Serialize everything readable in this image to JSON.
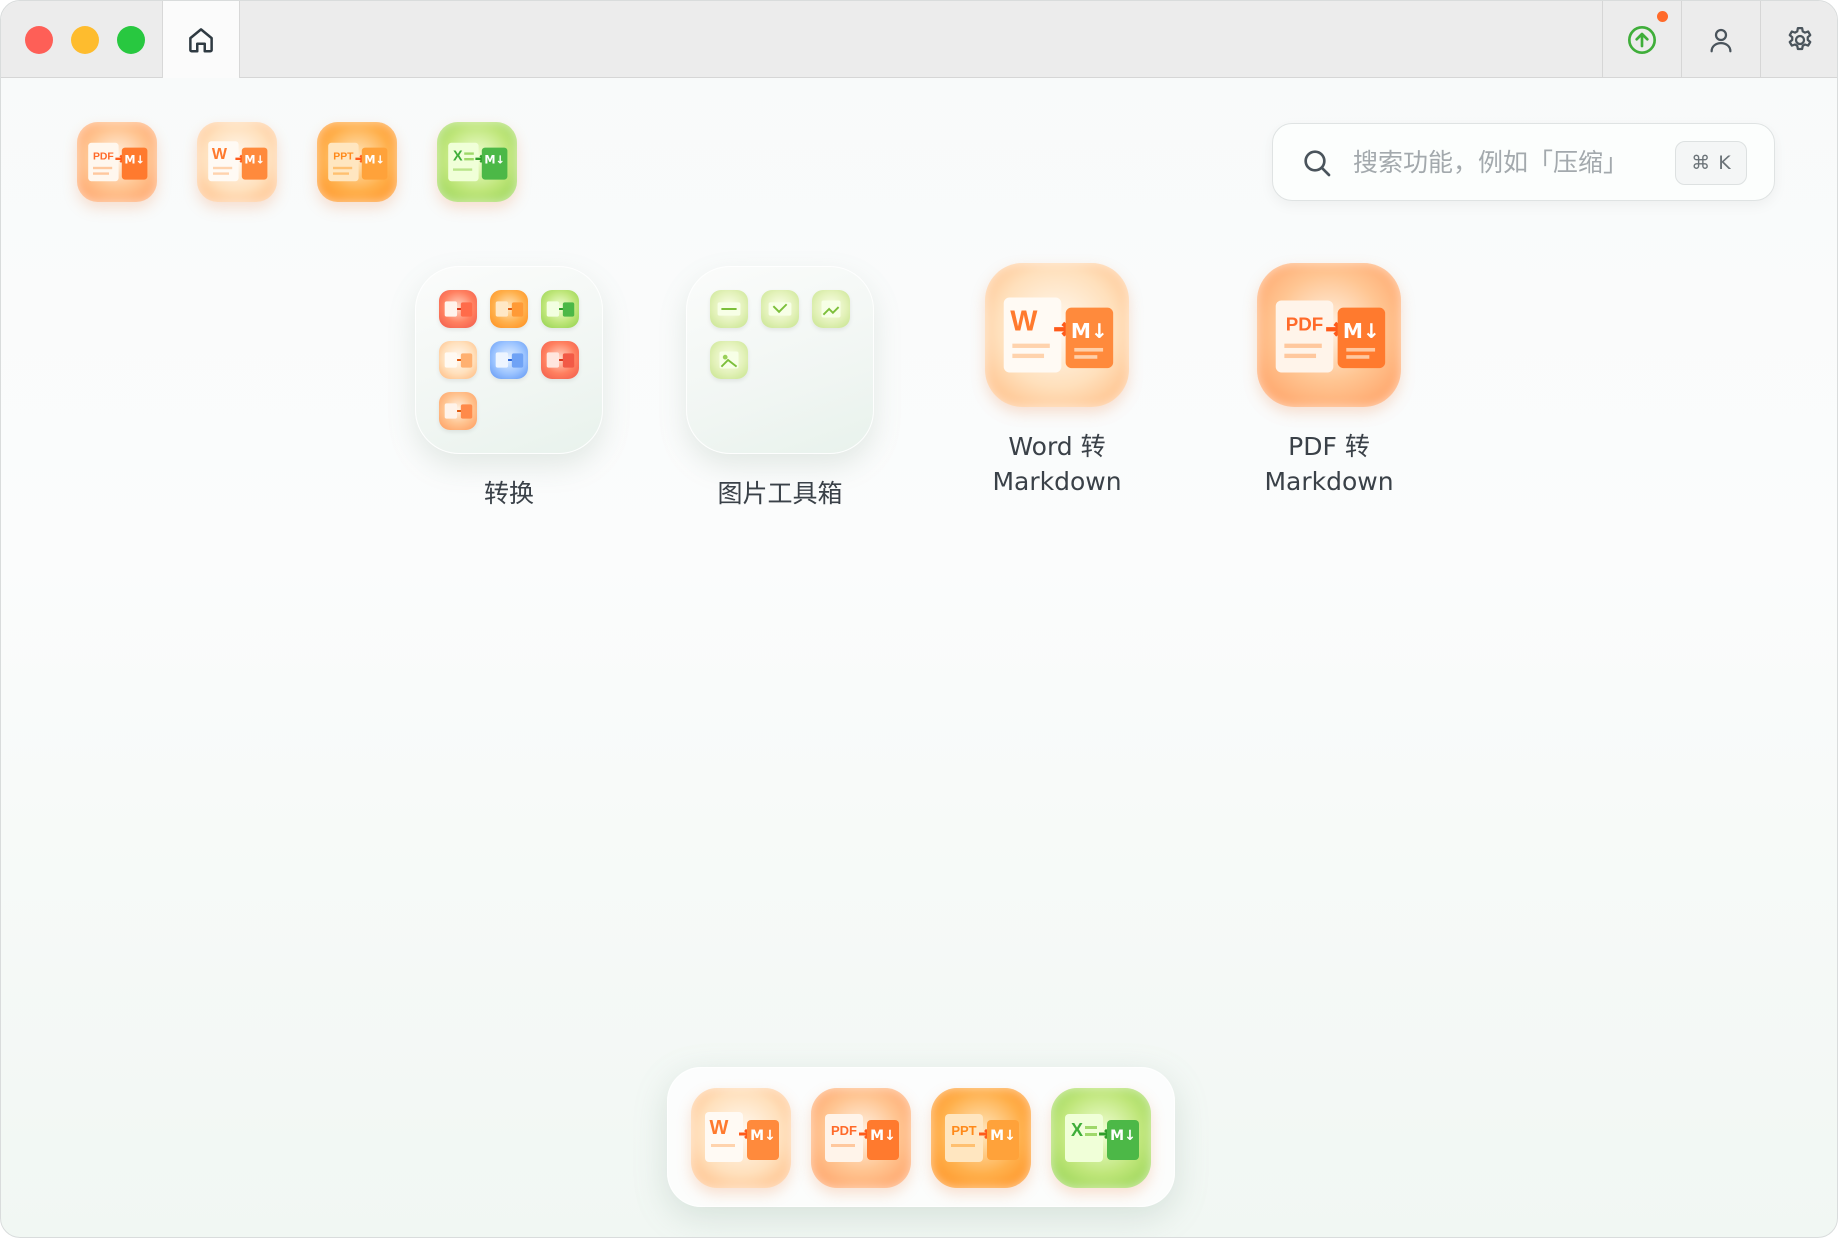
{
  "window": {
    "controls": [
      "close",
      "minimize",
      "maximize"
    ],
    "home_tab_icon": "home-icon",
    "toolbar_icons": [
      "upload-icon",
      "user-icon",
      "gear-icon"
    ],
    "update_badge": true
  },
  "shortcuts": [
    {
      "name": "pdf-to-markdown",
      "badge": "PDF",
      "theme": "orange"
    },
    {
      "name": "word-to-markdown",
      "badge": "W",
      "theme": "peach"
    },
    {
      "name": "ppt-to-markdown",
      "badge": "PPT",
      "theme": "amber"
    },
    {
      "name": "excel-to-markdown",
      "badge": "X",
      "theme": "green"
    }
  ],
  "search": {
    "placeholder": "搜索功能，例如「压缩」",
    "shortcut_symbol": "⌘",
    "shortcut_key": "K"
  },
  "grid": {
    "convert_folder": {
      "label": "转换"
    },
    "image_toolbox_folder": {
      "label": "图片工具箱"
    },
    "word_markdown": {
      "line1": "Word 转",
      "line2": "Markdown"
    },
    "pdf_markdown": {
      "line1": "PDF 转",
      "line2": "Markdown"
    }
  },
  "dock": [
    {
      "name": "word-to-markdown",
      "badge": "W",
      "theme": "peach"
    },
    {
      "name": "pdf-to-markdown",
      "badge": "PDF",
      "theme": "orange"
    },
    {
      "name": "ppt-to-markdown",
      "badge": "PPT",
      "theme": "amber"
    },
    {
      "name": "excel-to-markdown",
      "badge": "X",
      "theme": "green"
    }
  ],
  "colors": {
    "accent_orange": "#ff7a2e",
    "accent_green": "#3fae3a",
    "notify_dot": "#ff6a2a"
  },
  "markdown_badge": "M↓"
}
